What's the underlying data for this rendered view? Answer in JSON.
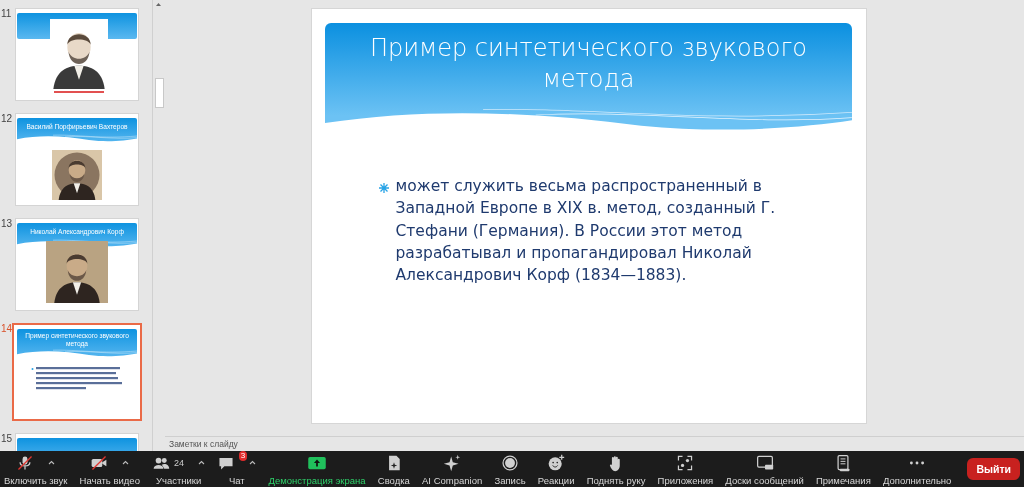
{
  "slide_panel": {
    "thumbnails": [
      {
        "number": "11",
        "kind": "portrait",
        "selected": false
      },
      {
        "number": "12",
        "title": "Василий  Порфирьевич Вахтеров",
        "selected": false
      },
      {
        "number": "13",
        "title": "Николай Александрович Корф",
        "selected": false
      },
      {
        "number": "14",
        "kind": "text",
        "title": "Пример синтетического звукового метода",
        "selected": true
      },
      {
        "number": "15",
        "kind": "blank",
        "selected": false
      }
    ]
  },
  "slide": {
    "title": "Пример синтетического звукового метода",
    "bullets": [
      "может служить весьма распространенный в Западной Европе в XIX в. метод, созданный   Г. Стефани (Германия). В России этот метод разрабатывал и пропагандировал Николай Александрович Корф (1834—1883)."
    ]
  },
  "notes": {
    "placeholder": "Заметки к слайду"
  },
  "toolbar": {
    "items": [
      {
        "kind": "mic",
        "label": "Включить звук",
        "off": true,
        "has_menu": true
      },
      {
        "kind": "video",
        "label": "Начать видео",
        "off": true,
        "has_menu": true
      },
      {
        "kind": "participants",
        "label": "Участники",
        "count": "24",
        "has_menu": true
      },
      {
        "kind": "chat",
        "label": "Чат",
        "badge": "3",
        "has_menu": true
      },
      {
        "kind": "share",
        "label": "Демонстрация экрана",
        "highlighted": true
      },
      {
        "kind": "summary",
        "label": "Сводка"
      },
      {
        "kind": "ai",
        "label": "AI Companion"
      },
      {
        "kind": "record",
        "label": "Запись"
      },
      {
        "kind": "reactions",
        "label": "Реакции"
      },
      {
        "kind": "hand",
        "label": "Поднять руку"
      },
      {
        "kind": "apps",
        "label": "Приложения"
      },
      {
        "kind": "boards",
        "label": "Доски сообщений"
      },
      {
        "kind": "notes",
        "label": "Примечания"
      },
      {
        "kind": "more",
        "label": "Дополнительно"
      }
    ],
    "leave": "Выйти"
  }
}
